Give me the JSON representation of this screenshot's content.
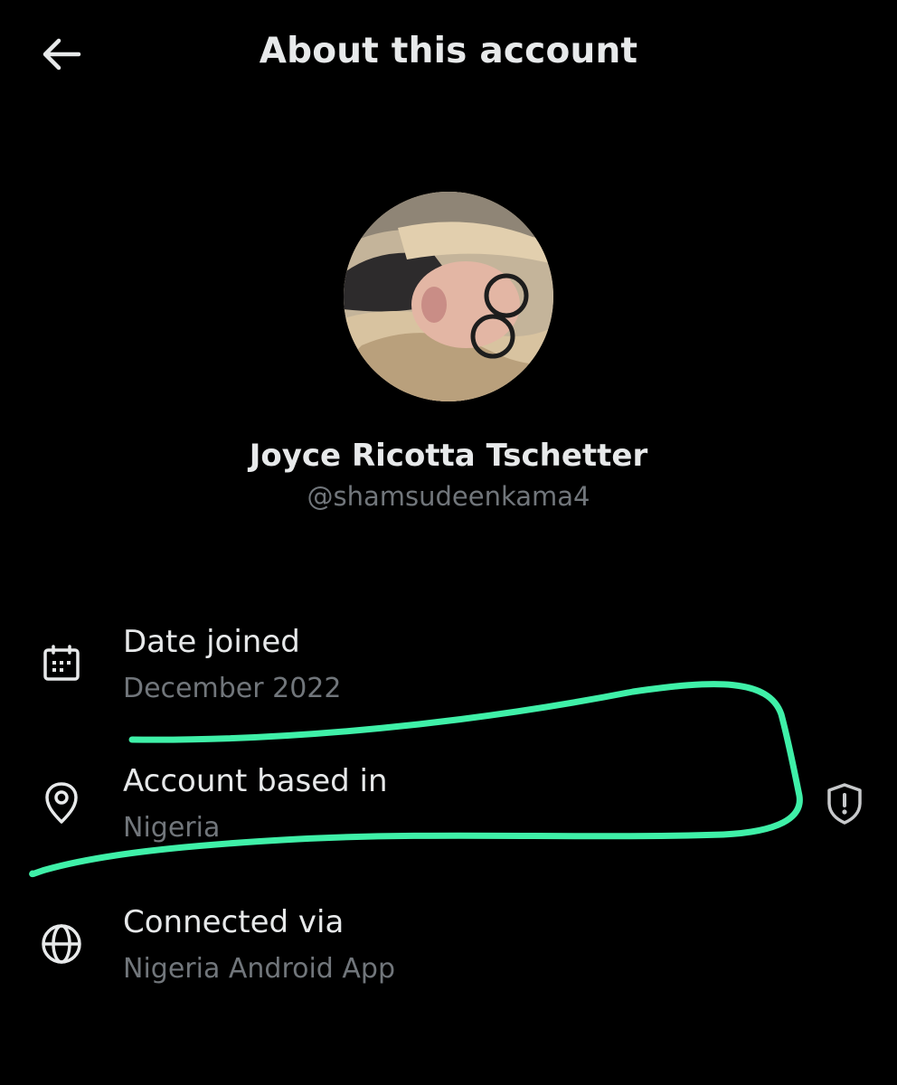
{
  "header": {
    "title": "About this account",
    "back_icon": "arrow-left-icon"
  },
  "profile": {
    "display_name": "Joyce Ricotta Tschetter",
    "handle": "@shamsudeenkama4"
  },
  "info": {
    "date_joined": {
      "label": "Date joined",
      "value": "December 2022",
      "icon": "calendar-icon"
    },
    "account_based_in": {
      "label": "Account based in",
      "value": "Nigeria",
      "icon": "location-pin-icon",
      "badge_icon": "shield-alert-icon"
    },
    "connected_via": {
      "label": "Connected via",
      "value": "Nigeria Android App",
      "icon": "globe-icon"
    }
  },
  "colors": {
    "background": "#000000",
    "primary_text": "#e7e9ea",
    "secondary_text": "#71767b",
    "annotation": "#3ff0a8"
  }
}
